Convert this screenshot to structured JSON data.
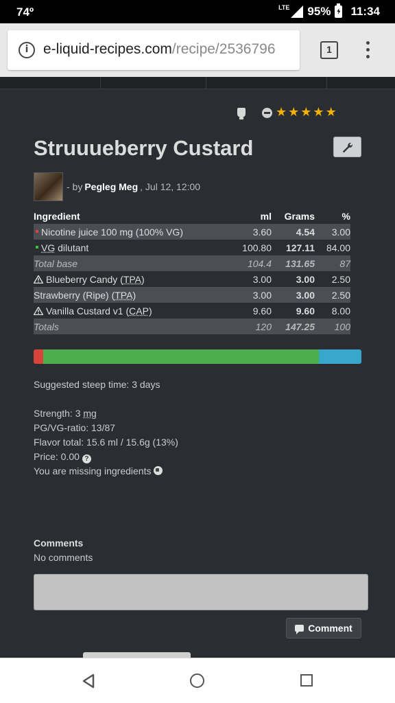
{
  "status_bar": {
    "temperature": "74º",
    "network": "LTE",
    "battery": "95%",
    "time": "11:34"
  },
  "browser": {
    "url_host": "e-liquid-recipes.com",
    "url_path": "/recipe/2536796",
    "tab_count": "1"
  },
  "recipe": {
    "title": "Struuueberry Custard",
    "author_prefix": "- by",
    "author": "Pegleg Meg",
    "date": ", Jul 12, 12:00",
    "rating_stars": 5
  },
  "table": {
    "headers": {
      "ingredient": "Ingredient",
      "ml": "ml",
      "grams": "Grams",
      "percent": "%"
    },
    "rows": [
      {
        "name": "Nicotine juice 100 mg (100% VG)",
        "ml": "3.60",
        "grams": "4.54",
        "percent": "3.00"
      },
      {
        "name_abbr": "VG",
        "name": " dilutant",
        "ml": "100.80",
        "grams": "127.11",
        "percent": "84.00"
      },
      {
        "name": "Total base",
        "ml": "104.4",
        "grams": "131.65",
        "percent": "87"
      },
      {
        "name": "Blueberry Candy (",
        "abbr": "TPA",
        "suffix": ")",
        "ml": "3.00",
        "grams": "3.00",
        "percent": "2.50"
      },
      {
        "name": "Strawberry (Ripe) (",
        "abbr": "TPA",
        "suffix": ")",
        "ml": "3.00",
        "grams": "3.00",
        "percent": "2.50"
      },
      {
        "name": "Vanilla Custard v1 (",
        "abbr": "CAP",
        "suffix": ")",
        "ml": "9.60",
        "grams": "9.60",
        "percent": "8.00"
      },
      {
        "name": "Totals",
        "ml": "120",
        "grams": "147.25",
        "percent": "100"
      }
    ]
  },
  "composition_bar": {
    "nicotine_pct": 3,
    "vg_pct": 84,
    "flavor_pct": 13,
    "colors": {
      "nicotine": "#d9443a",
      "vg": "#4cae4c",
      "flavor": "#38a7cc"
    }
  },
  "info": {
    "steep": "Suggested steep time: 3 days",
    "strength_label": "Strength: 3 ",
    "strength_unit": "mg",
    "ratio": "PG/VG-ratio: 13/87",
    "flavor_total": "Flavor total: 15.6 ml / 15.6g (13%)",
    "price": "Price: 0.00",
    "missing": "You are missing ingredients"
  },
  "comments": {
    "heading": "Comments",
    "empty": "No comments",
    "button": "Comment"
  },
  "icons": [
    "info-icon",
    "tab-switcher-icon",
    "menu-icon",
    "cup-icon",
    "minus-icon",
    "star-icon",
    "wrench-icon",
    "warning-icon",
    "help-icon",
    "remove-icon",
    "comment-icon",
    "back-icon",
    "home-icon",
    "recents-icon"
  ]
}
